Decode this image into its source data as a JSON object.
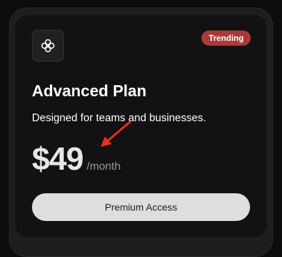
{
  "plan": {
    "badge": "Trending",
    "title": "Advanced Plan",
    "description": "Designed for teams and businesses.",
    "price": "$49",
    "period": "/month",
    "cta_label": "Premium Access",
    "icon": "flower-icon"
  },
  "colors": {
    "badge": "#a73a3a",
    "arrow": "#e8311e",
    "button": "#dedede"
  }
}
